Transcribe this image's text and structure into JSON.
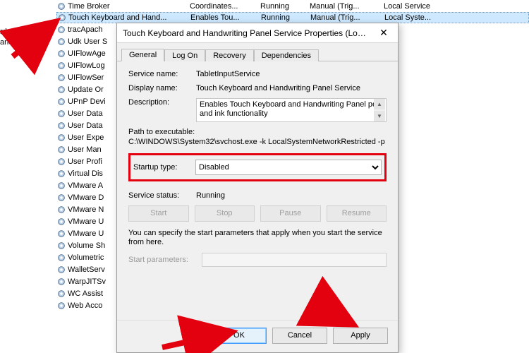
{
  "bg_snippet_line1": "rd and",
  "bg_snippet_line2": "and ink",
  "services": [
    {
      "name": "Time Broker",
      "desc": "Coordinates...",
      "status": "Running",
      "startup": "Manual (Trig...",
      "logon": "Local Service"
    },
    {
      "name": "Touch Keyboard and Hand...",
      "desc": "Enables Tou...",
      "status": "Running",
      "startup": "Manual (Trig...",
      "logon": "Local Syste...",
      "selected": true
    },
    {
      "name": "tracApach",
      "desc": "",
      "status": "",
      "startup": "",
      "logon": ""
    },
    {
      "name": "Udk User S",
      "desc": "",
      "status": "",
      "startup": "",
      "logon": ""
    },
    {
      "name": "UIFlowAge",
      "desc": "",
      "status": "",
      "startup": "",
      "logon": ""
    },
    {
      "name": "UIFlowLog",
      "desc": "",
      "status": "",
      "startup": "",
      "logon": ""
    },
    {
      "name": "UIFlowSer",
      "desc": "",
      "status": "",
      "startup": "",
      "logon": ""
    },
    {
      "name": "Update Or",
      "desc": "",
      "status": "",
      "startup": "",
      "logon": ""
    },
    {
      "name": "UPnP Devi",
      "desc": "",
      "status": "",
      "startup": "",
      "logon": ""
    },
    {
      "name": "User Data",
      "desc": "",
      "status": "",
      "startup": "",
      "logon": ""
    },
    {
      "name": "User Data",
      "desc": "",
      "status": "",
      "startup": "",
      "logon": ""
    },
    {
      "name": "User Expe",
      "desc": "",
      "status": "",
      "startup": "",
      "logon": ""
    },
    {
      "name": "User Man",
      "desc": "",
      "status": "",
      "startup": "",
      "logon": ""
    },
    {
      "name": "User Profi",
      "desc": "",
      "status": "",
      "startup": "",
      "logon": ""
    },
    {
      "name": "Virtual Dis",
      "desc": "",
      "status": "",
      "startup": "",
      "logon": ""
    },
    {
      "name": "VMware A",
      "desc": "",
      "status": "",
      "startup": "",
      "logon": ""
    },
    {
      "name": "VMware D",
      "desc": "",
      "status": "",
      "startup": "",
      "logon": ""
    },
    {
      "name": "VMware N",
      "desc": "",
      "status": "",
      "startup": "",
      "logon": ""
    },
    {
      "name": "VMware U",
      "desc": "",
      "status": "",
      "startup": "",
      "logon": ""
    },
    {
      "name": "VMware U",
      "desc": "",
      "status": "",
      "startup": "",
      "logon": ""
    },
    {
      "name": "Volume Sh",
      "desc": "",
      "status": "",
      "startup": "",
      "logon": ""
    },
    {
      "name": "Volumetric",
      "desc": "",
      "status": "",
      "startup": "",
      "logon": ""
    },
    {
      "name": "WalletServ",
      "desc": "",
      "status": "",
      "startup": "",
      "logon": ""
    },
    {
      "name": "WarpJITSv",
      "desc": "",
      "status": "",
      "startup": "",
      "logon": ""
    },
    {
      "name": "WC Assist",
      "desc": "",
      "status": "",
      "startup": "",
      "logon": ""
    },
    {
      "name": "Web Acco",
      "desc": "",
      "status": "",
      "startup": "",
      "logon": ""
    }
  ],
  "dialog": {
    "title": "Touch Keyboard and Handwriting Panel Service Properties (Local C...",
    "tabs": {
      "general": "General",
      "logon": "Log On",
      "recovery": "Recovery",
      "dependencies": "Dependencies"
    },
    "labels": {
      "service_name": "Service name:",
      "display_name": "Display name:",
      "description": "Description:",
      "path": "Path to executable:",
      "startup_type": "Startup type:",
      "service_status": "Service status:",
      "start_params": "Start parameters:"
    },
    "values": {
      "service_name": "TabletInputService",
      "display_name": "Touch Keyboard and Handwriting Panel Service",
      "description": "Enables Touch Keyboard and Handwriting Panel pen and ink functionality",
      "path": "C:\\WINDOWS\\System32\\svchost.exe -k LocalSystemNetworkRestricted -p",
      "startup_type": "Disabled",
      "service_status": "Running"
    },
    "buttons": {
      "start": "Start",
      "stop": "Stop",
      "pause": "Pause",
      "resume": "Resume"
    },
    "hint": "You can specify the start parameters that apply when you start the service from here.",
    "footer": {
      "ok": "OK",
      "cancel": "Cancel",
      "apply": "Apply"
    }
  }
}
